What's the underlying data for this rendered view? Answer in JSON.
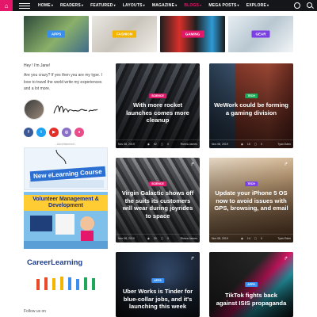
{
  "nav": {
    "items": [
      {
        "label": "HOME",
        "caret": true,
        "active": false
      },
      {
        "label": "READERS",
        "caret": true,
        "active": false
      },
      {
        "label": "FEATURED",
        "caret": true,
        "active": false
      },
      {
        "label": "LAYOUTS",
        "caret": true,
        "active": false
      },
      {
        "label": "MAGAZINE",
        "caret": true,
        "active": false
      },
      {
        "label": "BLOGS",
        "caret": true,
        "active": true
      },
      {
        "label": "MEGA POSTS",
        "caret": true,
        "active": false
      },
      {
        "label": "EXPLORE",
        "caret": true,
        "active": false
      }
    ],
    "accent": "#e4176b"
  },
  "categories": [
    {
      "label": "APPS",
      "color": "#3a8ef0"
    },
    {
      "label": "FASHION",
      "color": "#f4b400"
    },
    {
      "label": "GAMING",
      "color": "#e4176b"
    },
    {
      "label": "GEAR",
      "color": "#7b3fe4"
    }
  ],
  "sidebar": {
    "hey": "Hey ! I'm Jane!",
    "bio": "Are you crazy? If yes then you are my type. I love to travel the world write my experiences and a lot more.",
    "advertisement": "- Advertisement -",
    "ad1_title": "New eLearning Course",
    "ad2_title": "Volunteer Management & Development",
    "ad3_title": "CareerLearning",
    "follow": "Follow us on"
  },
  "socials": [
    {
      "icon": "facebook-icon",
      "glyph": "f",
      "color": "#3b5998"
    },
    {
      "icon": "twitter-icon",
      "glyph": "t",
      "color": "#1da1f2"
    },
    {
      "icon": "youtube-icon",
      "glyph": "▶",
      "color": "#e52d27"
    },
    {
      "icon": "instagram-icon",
      "glyph": "◎",
      "color": "#8a6fc8"
    },
    {
      "icon": "dribbble-icon",
      "glyph": "●",
      "color": "#ea4c89"
    }
  ],
  "cards": [
    {
      "tag": "SCIENCE",
      "tag_color": "#e4176b",
      "title": "With more rocket launches comes more cleanup",
      "date": "Nov 08, 2019",
      "views": "52",
      "comments": "0",
      "author": "Rivera James",
      "share": false
    },
    {
      "tag": "TECH",
      "tag_color": "#1fa85a",
      "title": "WeWork could be forming a gaming division",
      "date": "Nov 08, 2019",
      "views": "15",
      "comments": "0",
      "author": "Tyan Eden",
      "share": false
    },
    {
      "tag": "SCIENCE",
      "tag_color": "#e4176b",
      "title": "Virgin Galactic shows off the suits its customers will wear during joyrides to space",
      "date": "Nov 08, 2019",
      "views": "20",
      "comments": "0",
      "author": "Rivera James",
      "share": true
    },
    {
      "tag": "TECH",
      "tag_color": "#7b3fe4",
      "title": "Update your iPhone 5 OS now to avoid issues with GPS, browsing, and email",
      "date": "Nov 08, 2019",
      "views": "14",
      "comments": "0",
      "author": "Tyan Eden",
      "share": true
    },
    {
      "tag": "APPS",
      "tag_color": "#3a8ef0",
      "title": "Uber Works is Tinder for blue-collar jobs, and it's launching this week",
      "date": "",
      "views": "",
      "comments": "",
      "author": "",
      "share": true
    },
    {
      "tag": "APPS",
      "tag_color": "#3a8ef0",
      "title": "TikTok fights back against ISIS propaganda",
      "date": "",
      "views": "",
      "comments": "",
      "author": "",
      "share": true
    }
  ]
}
